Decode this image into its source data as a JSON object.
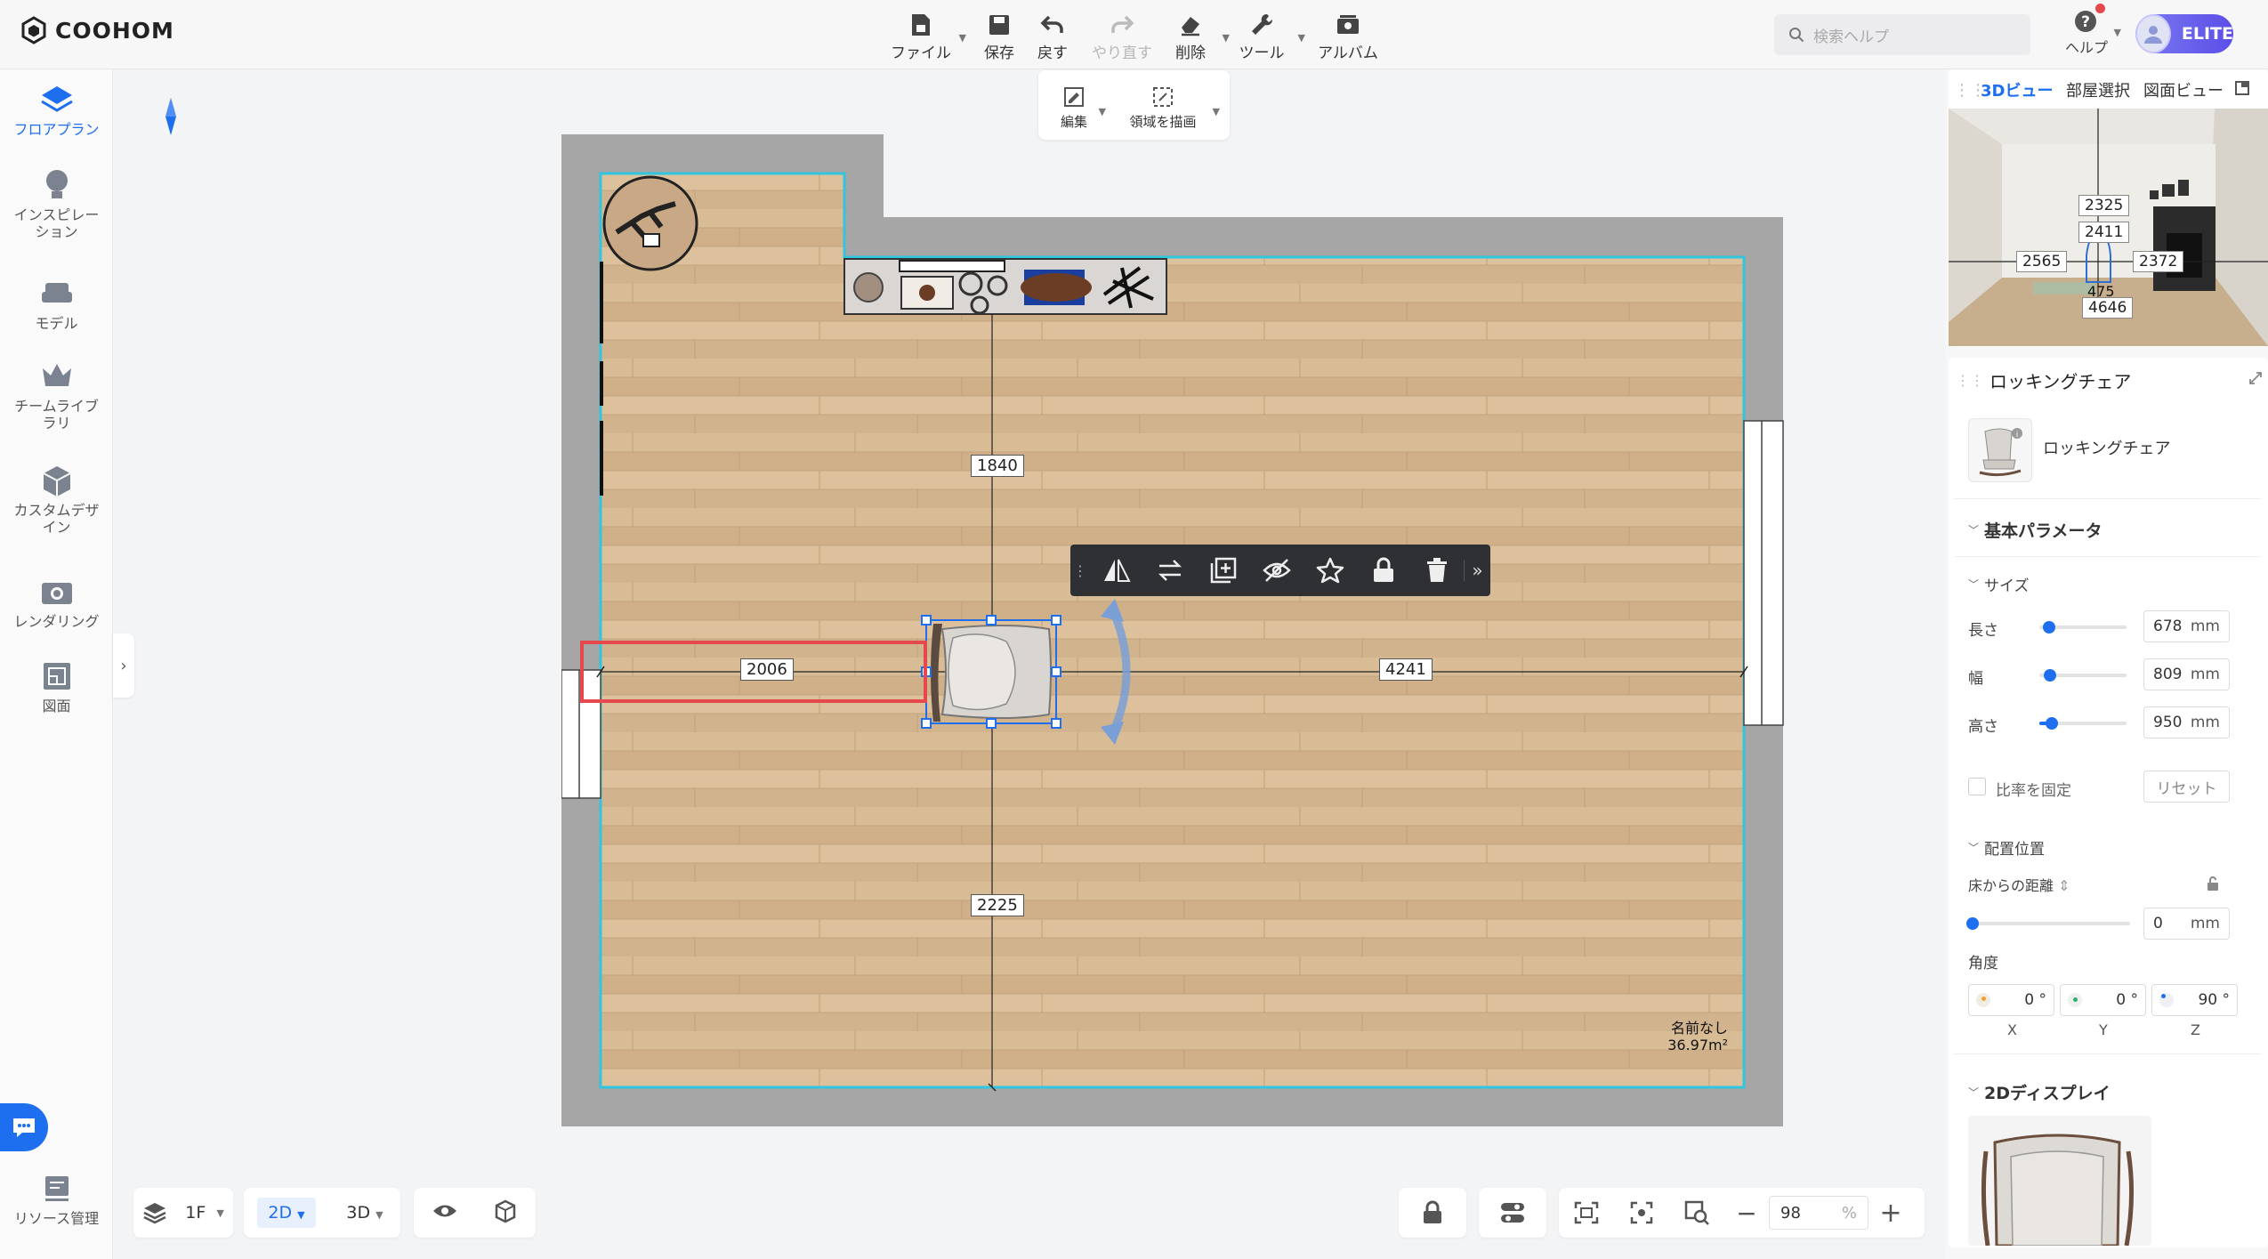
{
  "app": {
    "logo_text": "COOHOM"
  },
  "toolbar": {
    "file": "ファイル",
    "save": "保存",
    "undo": "戻す",
    "redo": "やり直す",
    "delete": "削除",
    "tools": "ツール",
    "album": "アルバム"
  },
  "subtoolbar": {
    "edit": "編集",
    "draw_area": "領域を描画"
  },
  "search": {
    "placeholder": "検索ヘルプ"
  },
  "help": {
    "label": "ヘルプ"
  },
  "badge": {
    "label": "ELITE"
  },
  "sidebar": {
    "items": [
      {
        "label": "フロアプラン",
        "icon": "floorplan-icon"
      },
      {
        "label": "インスピレーション",
        "icon": "bulb-icon"
      },
      {
        "label": "モデル",
        "icon": "sofa-icon"
      },
      {
        "label": "チームライブラリ",
        "icon": "crown-icon"
      },
      {
        "label": "カスタムデザイン",
        "icon": "box-icon"
      },
      {
        "label": "レンダリング",
        "icon": "camera-icon"
      },
      {
        "label": "図面",
        "icon": "drawing-icon"
      }
    ],
    "resource": "リソース管理"
  },
  "plan": {
    "dims": {
      "top": "1840",
      "left": "2006",
      "right": "4241",
      "bottom": "2225"
    },
    "room_name": "名前なし",
    "room_area": "36.97m²"
  },
  "preview": {
    "tabs": [
      "3Dビュー",
      "部屋選択",
      "図面ビュー"
    ],
    "dims": {
      "a": "2325",
      "b": "2411",
      "c": "2565",
      "d": "2372",
      "e": "475",
      "f": "4646"
    }
  },
  "props": {
    "header": "ロッキングチェア",
    "item_name": "ロッキングチェア",
    "basic_params": "基本パラメータ",
    "size_title": "サイズ",
    "length_label": "長さ",
    "length_value": "678",
    "width_label": "幅",
    "width_value": "809",
    "height_label": "高さ",
    "height_value": "950",
    "unit": "mm",
    "lock_ratio": "比率を固定",
    "reset": "リセット",
    "placement_title": "配置位置",
    "floor_distance": "床からの距離",
    "floor_value": "0",
    "angle_label": "角度",
    "angle_x": "0 °",
    "angle_y": "0 °",
    "angle_z": "90 °",
    "axis_x": "X",
    "axis_y": "Y",
    "axis_z": "Z",
    "display_2d": "2Dディスプレイ"
  },
  "bottom": {
    "floor": "1F",
    "mode_2d": "2D",
    "mode_3d": "3D",
    "zoom": "98",
    "zoom_unit": "%"
  },
  "colors": {
    "accent": "#1e6ff0",
    "wall": "#a6a6a6",
    "room_outline": "#31c6e0",
    "highlight": "#e5484d"
  }
}
